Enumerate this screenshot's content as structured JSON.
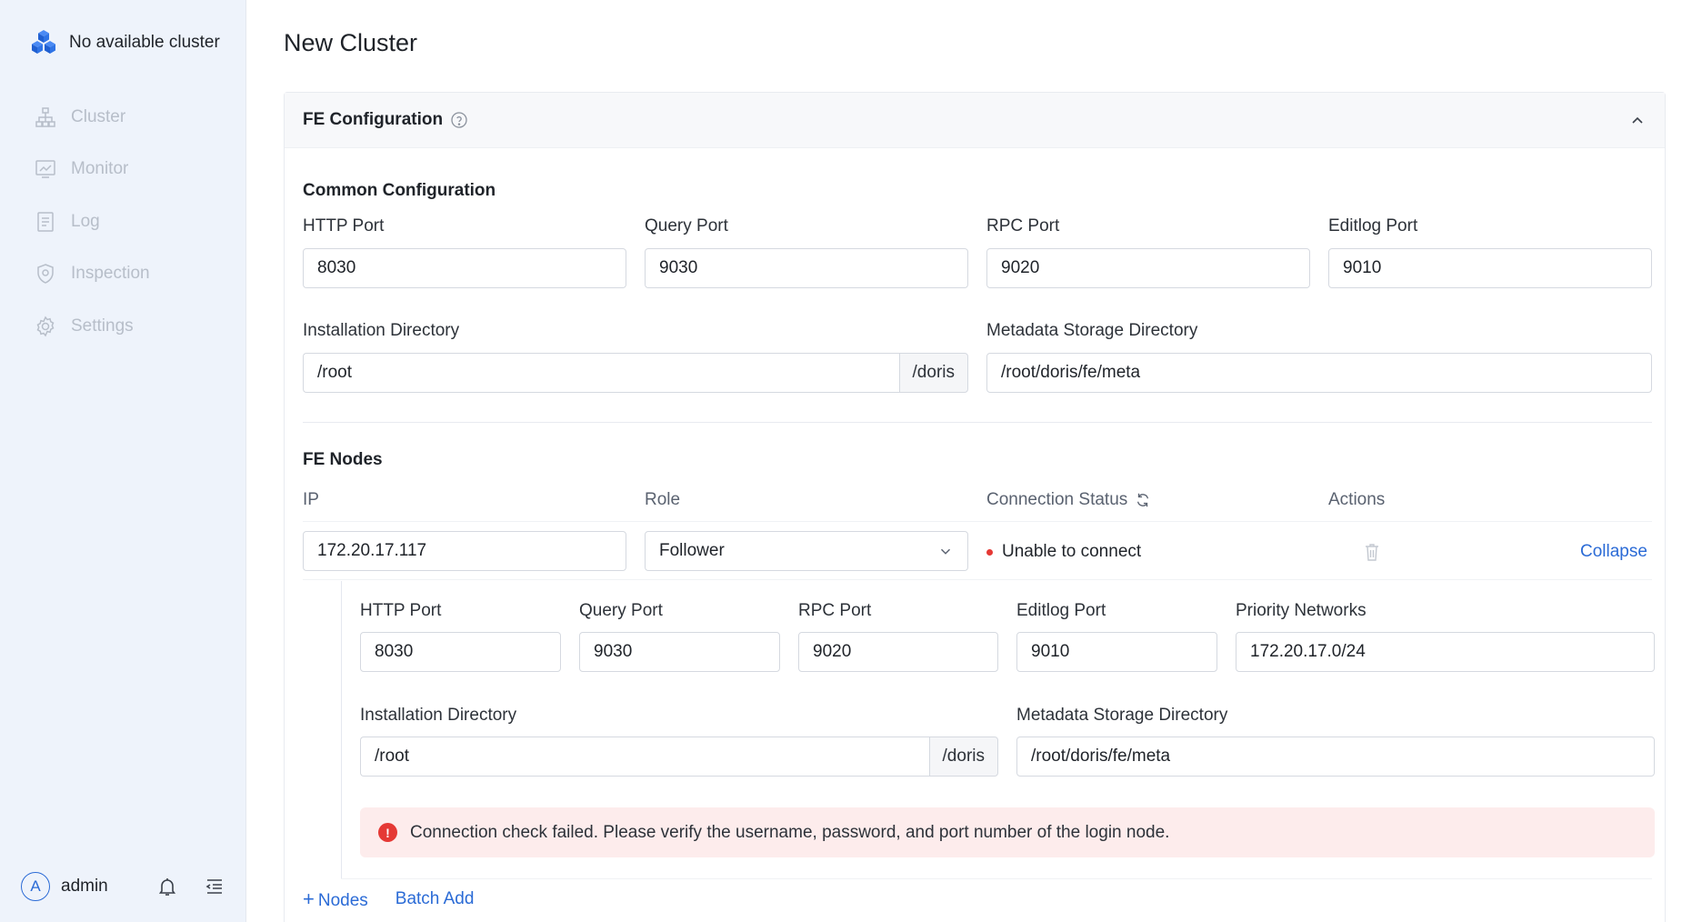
{
  "sidebar": {
    "cluster_label": "No available cluster",
    "nav": [
      {
        "label": "Cluster",
        "icon": "cluster-icon"
      },
      {
        "label": "Monitor",
        "icon": "monitor-icon"
      },
      {
        "label": "Log",
        "icon": "log-icon"
      },
      {
        "label": "Inspection",
        "icon": "shield-icon"
      },
      {
        "label": "Settings",
        "icon": "gear-icon"
      }
    ],
    "user": {
      "avatar_letter": "A",
      "name": "admin"
    }
  },
  "page": {
    "title": "New Cluster"
  },
  "panel": {
    "title": "FE Configuration",
    "common": {
      "title": "Common Configuration",
      "http_port": {
        "label": "HTTP Port",
        "value": "8030"
      },
      "query_port": {
        "label": "Query Port",
        "value": "9030"
      },
      "rpc_port": {
        "label": "RPC Port",
        "value": "9020"
      },
      "editlog_port": {
        "label": "Editlog Port",
        "value": "9010"
      },
      "install_dir": {
        "label": "Installation Directory",
        "value": "/root",
        "suffix": "/doris"
      },
      "meta_dir": {
        "label": "Metadata Storage Directory",
        "value": "/root/doris/fe/meta"
      }
    },
    "nodes": {
      "title": "FE Nodes",
      "columns": {
        "ip": "IP",
        "role": "Role",
        "status": "Connection Status",
        "actions": "Actions"
      },
      "row": {
        "ip": "172.20.17.117",
        "role": "Follower",
        "status": "Unable to connect",
        "collapse_label": "Collapse"
      },
      "detail": {
        "http_port": {
          "label": "HTTP Port",
          "value": "8030"
        },
        "query_port": {
          "label": "Query Port",
          "value": "9030"
        },
        "rpc_port": {
          "label": "RPC Port",
          "value": "9020"
        },
        "editlog_port": {
          "label": "Editlog Port",
          "value": "9010"
        },
        "priority_networks": {
          "label": "Priority Networks",
          "value": "172.20.17.0/24"
        },
        "install_dir": {
          "label": "Installation Directory",
          "value": "/root",
          "suffix": "/doris"
        },
        "meta_dir": {
          "label": "Metadata Storage Directory",
          "value": "/root/doris/fe/meta"
        },
        "alert": "Connection check failed. Please verify the username, password, and port number of the login node."
      },
      "add_nodes_label": "Nodes",
      "batch_add_label": "Batch Add"
    }
  },
  "colors": {
    "accent": "#2b6bd6",
    "error": "#e53935",
    "sidebar_bg": "#eef3fb"
  }
}
